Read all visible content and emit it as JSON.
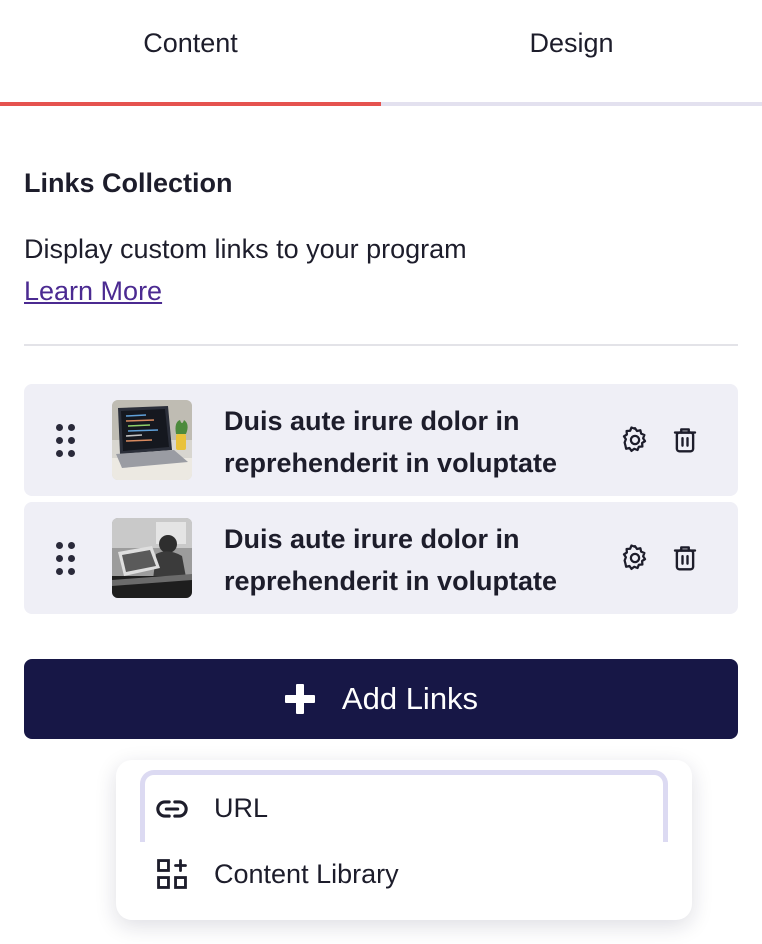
{
  "tabs": {
    "content_label": "Content",
    "design_label": "Design"
  },
  "section": {
    "title": "Links Collection",
    "description": "Display custom links to your program",
    "learn_more": "Learn More"
  },
  "links": [
    {
      "title": "Duis aute irure dolor in reprehenderit in voluptate"
    },
    {
      "title": "Duis aute irure dolor in reprehenderit in voluptate"
    }
  ],
  "add_button": {
    "label": "Add Links"
  },
  "dropdown": {
    "items": [
      {
        "label": "URL",
        "icon": "link-icon"
      },
      {
        "label": "Content Library",
        "icon": "grid-plus-icon"
      }
    ]
  },
  "colors": {
    "active_tab_underline": "#e5524f",
    "primary_button": "#171746",
    "link_text": "#4b2a91"
  }
}
